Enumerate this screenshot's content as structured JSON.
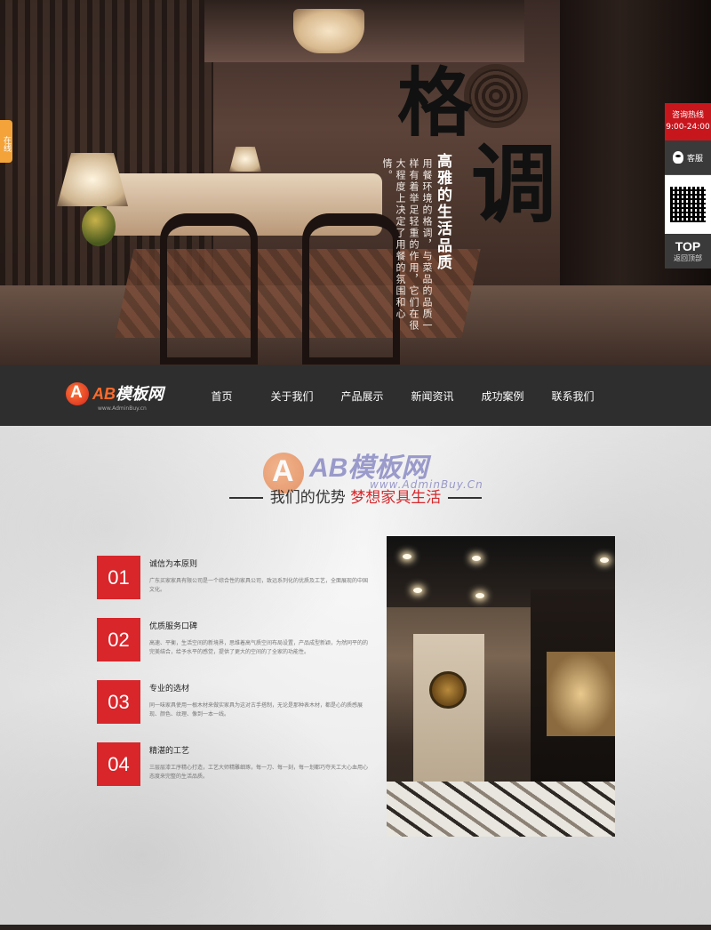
{
  "hero": {
    "title_line1": "格",
    "title_line2": "调",
    "subtitle": "高雅的生活品质",
    "description": "用餐环境的格调，与菜品的品质一样有着举足轻重的作用，它们在很大程度上决定了用餐的氛围和心情。",
    "side_tab": "在线"
  },
  "float_panel": {
    "hotline_label": "咨询热线",
    "hotline_hours": "9:00-24:00",
    "service_label": "客服",
    "top_label": "TOP",
    "top_sub": "返回顶部"
  },
  "nav": {
    "logo_text_prefix": "AB",
    "logo_text_suffix": "模板网",
    "logo_url": "www.AdminBuy.cn",
    "items": [
      "首页",
      "关于我们",
      "产品展示",
      "新闻资讯",
      "成功案例",
      "联系我们"
    ]
  },
  "watermark": {
    "text": "AB模板网",
    "url": "www.AdminBuy.Cn"
  },
  "section": {
    "title": "我们的优势",
    "accent": "梦想家具生活"
  },
  "features": [
    {
      "num": "01",
      "title": "诚信为本原则",
      "text": "广东买家家具有限公司是一个综合性的家具公司，致远系列化的优质及工艺，全面展现的中国文化。"
    },
    {
      "num": "02",
      "title": "优质服务口碑",
      "text": "高速、平衡，生活空间的新境界，思维着高气质空间布局设置，产品成型新颖，为然同平的的完美结合，给予水平的感觉，提供了更大的空间的了全家的功能性。"
    },
    {
      "num": "03",
      "title": "专业的选材",
      "text": "同一味家具使用一根木材来做实家具为这对古手搭制，无论是那种表木材，都是心的质感展现、颜色、纹理、像到一本一线。"
    },
    {
      "num": "04",
      "title": "精湛的工艺",
      "text": "三层层漆工序精心打造，工艺大师精雕细琢，每一刀、每一刻，每一划都巧夺天工大心血用心态度来完整的生活品质。"
    }
  ],
  "colors": {
    "accent": "#d8262b",
    "nav_bg": "#2e2e2e",
    "hotline_bg": "#c8161d"
  }
}
